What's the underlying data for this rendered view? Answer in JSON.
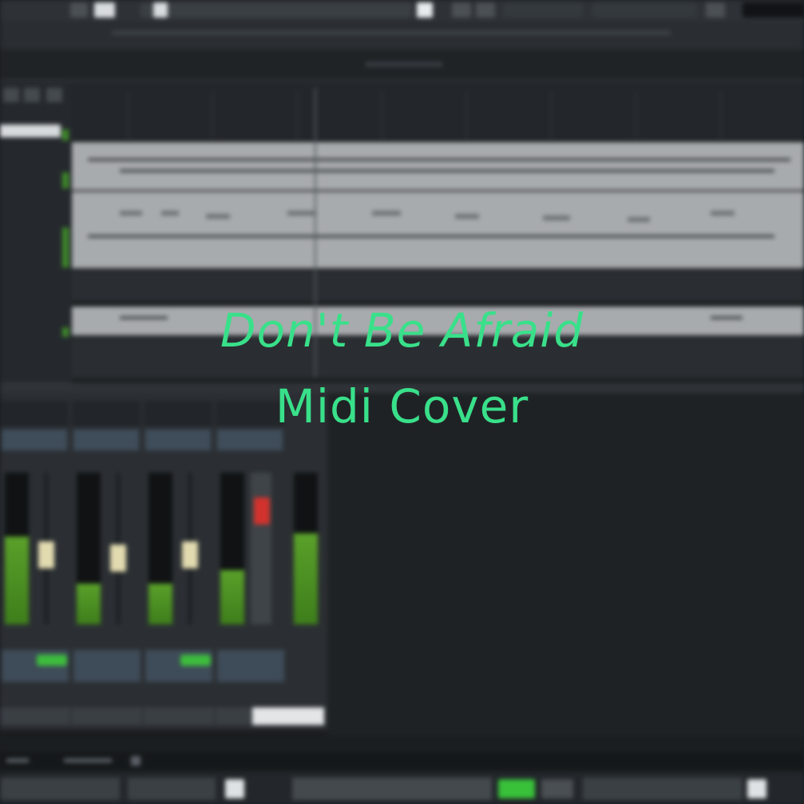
{
  "overlay": {
    "line1": "Don't Be Afraid",
    "line2": "Midi Cover"
  },
  "colors": {
    "caption": "#39e08a",
    "meter_green": "#5aa02a",
    "record_red": "#d2322d",
    "accent_green": "#3dbd3d"
  },
  "mixer": {
    "strips": [
      {
        "meter_level": 0.58,
        "fader_level": 0.45,
        "fader_color": "cream"
      },
      {
        "meter_level": 0.27,
        "fader_level": 0.42,
        "fader_color": "cream"
      },
      {
        "meter_level": 0.27,
        "fader_level": 0.45,
        "fader_color": "cream"
      },
      {
        "meter_level": 0.36,
        "fader_level": 0.8,
        "fader_color": "red"
      },
      {
        "meter_level": 0.6
      }
    ]
  },
  "icons": {
    "play": "play-icon",
    "record": "record-icon",
    "loop": "loop-icon"
  }
}
